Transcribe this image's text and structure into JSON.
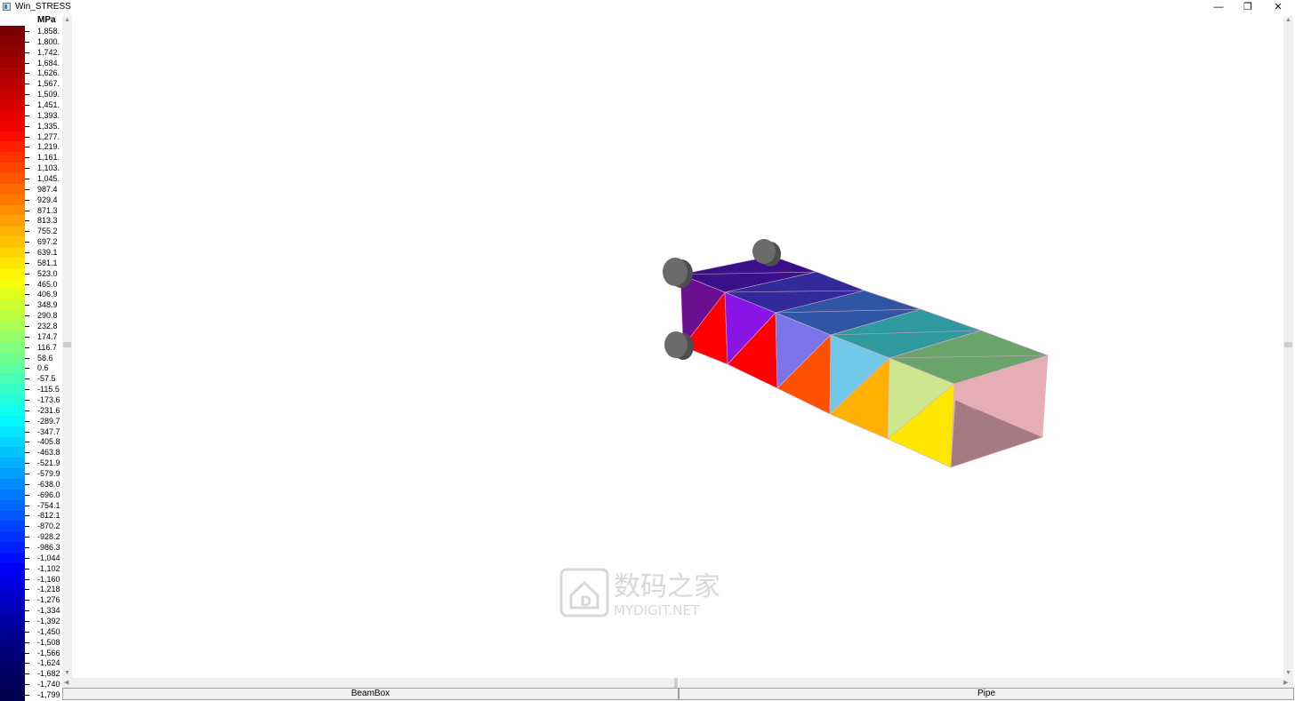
{
  "window": {
    "title": "Win_STRESS",
    "minimize_glyph": "—",
    "restore_glyph": "❐",
    "close_glyph": "✕"
  },
  "legend": {
    "unit": "MPa",
    "labels": [
      "1,858.",
      "1,800.",
      "1,742.",
      "1,684.",
      "1,626.",
      "1,567.",
      "1,509.",
      "1,451.",
      "1,393.",
      "1,335.",
      "1,277.",
      "1,219.",
      "1,161.",
      "1,103.",
      "1,045.",
      "987.4",
      "929.4",
      "871.3",
      "813.3",
      "755.2",
      "697.2",
      "639.1",
      "581.1",
      "523.0",
      "465.0",
      "406.9",
      "348.9",
      "290.8",
      "232.8",
      "174.7",
      "116.7",
      "58.6",
      "0.6",
      "-57.5",
      "-115.5",
      "-173.6",
      "-231.6",
      "-289.7",
      "-347.7",
      "-405.8",
      "-463.8",
      "-521.9",
      "-579.9",
      "-638.0",
      "-696.0",
      "-754.1",
      "-812.1",
      "-870.2",
      "-928.2",
      "-986.3",
      "-1,044",
      "-1,102",
      "-1,160",
      "-1,218",
      "-1,276",
      "-1,334",
      "-1,392",
      "-1,450",
      "-1,508",
      "-1,566",
      "-1,624",
      "-1,682",
      "-1,740",
      "-1,799"
    ],
    "colors": [
      "#7a0000",
      "#860000",
      "#930000",
      "#a00000",
      "#ad0000",
      "#ba0000",
      "#c80000",
      "#d60000",
      "#e40000",
      "#f20000",
      "#ff0c00",
      "#ff2000",
      "#ff3300",
      "#ff4500",
      "#ff5700",
      "#ff6900",
      "#ff7b00",
      "#ff8d00",
      "#ff9f00",
      "#ffb000",
      "#ffc200",
      "#ffd400",
      "#ffe600",
      "#fff700",
      "#f4ff0a",
      "#e1ff1d",
      "#ceff30",
      "#bbff43",
      "#a8ff56",
      "#95ff69",
      "#82ff7c",
      "#6fff8f",
      "#5cffa2",
      "#49ffb5",
      "#36ffc8",
      "#23ffdb",
      "#10ffee",
      "#00f8ff",
      "#00e6ff",
      "#00d4ff",
      "#00c2ff",
      "#00b0ff",
      "#009eff",
      "#008cff",
      "#007aff",
      "#0068ff",
      "#0056ff",
      "#0044ff",
      "#0032ff",
      "#0020ff",
      "#000eff",
      "#0000f6",
      "#0000e6",
      "#0000d6",
      "#0000c6",
      "#0000b6",
      "#0000a6",
      "#000096",
      "#000086",
      "#000078",
      "#00006c",
      "#000062",
      "#00005a",
      "#000052"
    ]
  },
  "model": {
    "faces": [
      {
        "id": "top-1",
        "fill": "#3a0f8a",
        "points": [
          [
            765,
            309
          ],
          [
            868,
            288
          ],
          [
            918,
            306
          ],
          [
            815,
            329
          ]
        ]
      },
      {
        "id": "top-2",
        "fill": "#322a9a",
        "points": [
          [
            815,
            329
          ],
          [
            918,
            306
          ],
          [
            972,
            327
          ],
          [
            872,
            352
          ]
        ]
      },
      {
        "id": "top-3",
        "fill": "#2f56a5",
        "points": [
          [
            872,
            352
          ],
          [
            972,
            327
          ],
          [
            1035,
            348
          ],
          [
            934,
            377
          ]
        ]
      },
      {
        "id": "top-4",
        "fill": "#2f9aa0",
        "points": [
          [
            934,
            377
          ],
          [
            1035,
            348
          ],
          [
            1103,
            372
          ],
          [
            1000,
            403
          ]
        ]
      },
      {
        "id": "top-5",
        "fill": "#6aa46a",
        "points": [
          [
            1000,
            403
          ],
          [
            1103,
            372
          ],
          [
            1178,
            400
          ],
          [
            1073,
            432
          ]
        ]
      },
      {
        "id": "end-cap",
        "fill": "#e6adb5",
        "points": [
          [
            1073,
            432
          ],
          [
            1178,
            400
          ],
          [
            1172,
            492
          ],
          [
            1069,
            526
          ]
        ]
      },
      {
        "id": "bottom-end",
        "fill": "#a57a82",
        "points": [
          [
            1069,
            526
          ],
          [
            1172,
            492
          ],
          [
            1074,
            450
          ]
        ]
      },
      {
        "id": "root-side",
        "fill": "#6a0f90",
        "points": [
          [
            765,
            309
          ],
          [
            815,
            329
          ],
          [
            818,
            410
          ],
          [
            768,
            390
          ]
        ]
      },
      {
        "id": "side-1a",
        "fill": "#ff0000",
        "points": [
          [
            768,
            390
          ],
          [
            815,
            329
          ],
          [
            818,
            410
          ]
        ]
      },
      {
        "id": "side-1b",
        "fill": "#8a14e6",
        "points": [
          [
            815,
            329
          ],
          [
            872,
            352
          ],
          [
            818,
            410
          ]
        ]
      },
      {
        "id": "side-2a",
        "fill": "#ff0000",
        "points": [
          [
            818,
            410
          ],
          [
            872,
            352
          ],
          [
            874,
            437
          ]
        ]
      },
      {
        "id": "side-2b",
        "fill": "#7a74e8",
        "points": [
          [
            872,
            352
          ],
          [
            934,
            377
          ],
          [
            874,
            437
          ]
        ]
      },
      {
        "id": "side-3a",
        "fill": "#ff5000",
        "points": [
          [
            874,
            437
          ],
          [
            934,
            377
          ],
          [
            933,
            466
          ]
        ]
      },
      {
        "id": "side-3b",
        "fill": "#72c8e8",
        "points": [
          [
            934,
            377
          ],
          [
            1000,
            403
          ],
          [
            933,
            466
          ]
        ]
      },
      {
        "id": "side-4a",
        "fill": "#ffb000",
        "points": [
          [
            933,
            466
          ],
          [
            1000,
            403
          ],
          [
            998,
            494
          ]
        ]
      },
      {
        "id": "side-4b",
        "fill": "#cce68e",
        "points": [
          [
            1000,
            403
          ],
          [
            1073,
            432
          ],
          [
            998,
            494
          ]
        ]
      },
      {
        "id": "side-5a",
        "fill": "#ffe600",
        "points": [
          [
            998,
            494
          ],
          [
            1073,
            432
          ],
          [
            1069,
            526
          ]
        ]
      }
    ]
  },
  "tabs": [
    {
      "label": "BeamBox"
    },
    {
      "label": "Pipe"
    }
  ],
  "watermark": {
    "text_cn": "数码之家",
    "text_en": "MYDIGIT.NET"
  }
}
